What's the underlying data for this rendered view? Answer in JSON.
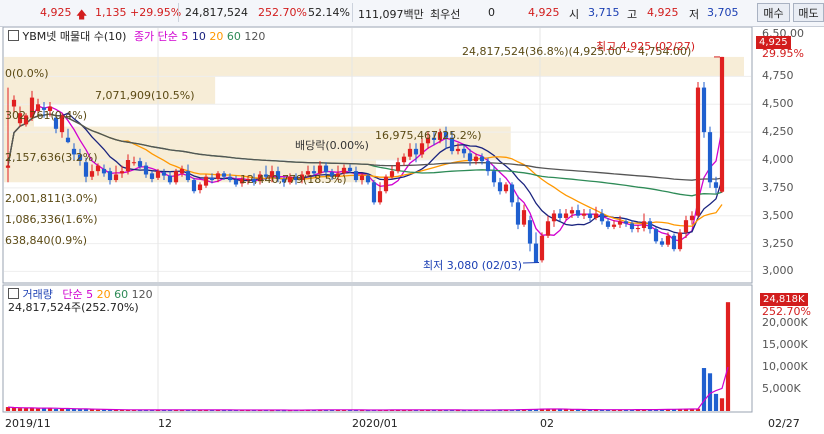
{
  "toolbar": {
    "price": "4,925",
    "change": "1,135",
    "change_pct": "+29.95%",
    "volume": "24,817,524",
    "vol_ratio": "252.70%",
    "turnover_pct": "52.14%",
    "amount": "111,097백만",
    "best_sell_label": "최우선",
    "best_sell_qty": "0",
    "best_price": "4,925",
    "open_label": "시",
    "open": "3,715",
    "high_label": "고",
    "high": "4,925",
    "low_label": "저",
    "low": "3,705",
    "buy_button": "매수",
    "sell_button": "매도"
  },
  "price_panel": {
    "title": "YBM넷 매물대 수(10)",
    "ma_label": "종가 단순",
    "ma_periods": [
      "5",
      "10",
      "20",
      "60",
      "120"
    ],
    "ma_colors": [
      "#d000d0",
      "#1a237e",
      "#ff9800",
      "#2e8b57",
      "#555555"
    ],
    "top_right_partial": "6,50.00",
    "price_badge": "4,925",
    "pct_badge": "29.95%",
    "high_annotation": "최고 4,925 (02/27)",
    "low_annotation": "최저 3,080 (02/03)",
    "dividend_label": "배당락(0.00%)",
    "volume_profile_labels": [
      "24,817,524(36.8%)(4,925.00 ~ 4,754.00)",
      "7,071,909(10.5%)",
      "16,975,467(25.2%)",
      "2,157,636(3.2%)",
      "12,440,779(18.5%)",
      "2,001,811(3.0%)",
      "1,086,336(1.6%)",
      "638,840(0.9%)",
      "302,761(0.4%)",
      "0(0.0%)"
    ],
    "y_ticks": [
      "4,750",
      "4,500",
      "4,250",
      "4,000",
      "3,750",
      "3,500",
      "3,250",
      "3,000"
    ]
  },
  "volume_panel": {
    "title": "거래량",
    "ma_label": "단순",
    "ma_periods": [
      "5",
      "20",
      "60",
      "120"
    ],
    "current": "24,817,524주(252.70%)",
    "vol_badge": "24,818K",
    "pct_badge": "252.70%",
    "y_ticks": [
      "20,000K",
      "15,000K",
      "10,000K",
      "5,000K"
    ]
  },
  "x_axis": {
    "ticks": [
      "2019/11",
      "12",
      "2020/01",
      "02"
    ],
    "right_label": "02/27"
  },
  "chart_data": {
    "type": "candlestick",
    "ylim": [
      2950,
      5050
    ],
    "candles": [
      [
        3930,
        3950,
        3800,
        4650
      ],
      [
        4480,
        4540,
        4420,
        4580
      ],
      [
        4330,
        4420,
        4300,
        4480
      ],
      [
        4320,
        4400,
        4300,
        4420
      ],
      [
        4380,
        4560,
        4350,
        4620
      ],
      [
        4440,
        4500,
        4400,
        4550
      ],
      [
        4470,
        4450,
        4380,
        4520
      ],
      [
        4440,
        4480,
        4390,
        4520
      ],
      [
        4380,
        4280,
        4240,
        4420
      ],
      [
        4250,
        4400,
        4200,
        4420
      ],
      [
        4200,
        4160,
        4150,
        4280
      ],
      [
        4100,
        4050,
        4000,
        4150
      ],
      [
        4050,
        4000,
        3950,
        4100
      ],
      [
        3980,
        3850,
        3800,
        4020
      ],
      [
        3850,
        3900,
        3820,
        3960
      ],
      [
        3900,
        3950,
        3860,
        3970
      ],
      [
        3920,
        3880,
        3850,
        3960
      ],
      [
        3900,
        3820,
        3780,
        3930
      ],
      [
        3820,
        3870,
        3800,
        3950
      ],
      [
        3880,
        3900,
        3840,
        3950
      ],
      [
        3900,
        4000,
        3870,
        4050
      ],
      [
        3980,
        3980,
        3950,
        4030
      ],
      [
        3990,
        3940,
        3920,
        4020
      ],
      [
        3950,
        3870,
        3840,
        3980
      ],
      [
        3880,
        3830,
        3800,
        3900
      ],
      [
        3840,
        3900,
        3820,
        3920
      ],
      [
        3890,
        3860,
        3820,
        3920
      ],
      [
        3860,
        3800,
        3780,
        3900
      ],
      [
        3800,
        3900,
        3780,
        3920
      ],
      [
        3880,
        3920,
        3850,
        3950
      ],
      [
        3900,
        3820,
        3800,
        3960
      ],
      [
        3820,
        3720,
        3700,
        3840
      ],
      [
        3730,
        3780,
        3700,
        3800
      ],
      [
        3770,
        3850,
        3750,
        3870
      ],
      [
        3840,
        3820,
        3790,
        3880
      ],
      [
        3830,
        3880,
        3800,
        3900
      ],
      [
        3880,
        3850,
        3820,
        3900
      ],
      [
        3850,
        3820,
        3800,
        3880
      ],
      [
        3820,
        3780,
        3760,
        3860
      ],
      [
        3790,
        3830,
        3760,
        3850
      ],
      [
        3830,
        3830,
        3780,
        3860
      ],
      [
        3830,
        3800,
        3770,
        3880
      ],
      [
        3810,
        3870,
        3780,
        3900
      ],
      [
        3870,
        3850,
        3820,
        3950
      ],
      [
        3850,
        3900,
        3800,
        3950
      ],
      [
        3900,
        3830,
        3800,
        3940
      ],
      [
        3830,
        3800,
        3760,
        3850
      ],
      [
        3800,
        3850,
        3780,
        3880
      ],
      [
        3850,
        3820,
        3780,
        3880
      ],
      [
        3820,
        3870,
        3790,
        3900
      ],
      [
        3870,
        3900,
        3850,
        3950
      ],
      [
        3900,
        3880,
        3860,
        3950
      ],
      [
        3880,
        3950,
        3860,
        3990
      ],
      [
        3950,
        3890,
        3850,
        3980
      ],
      [
        3890,
        3850,
        3820,
        3920
      ],
      [
        3850,
        3880,
        3820,
        3950
      ],
      [
        3880,
        3930,
        3860,
        3960
      ],
      [
        3930,
        3900,
        3880,
        3960
      ],
      [
        3900,
        3820,
        3800,
        3940
      ],
      [
        3820,
        3860,
        3780,
        3880
      ],
      [
        3860,
        3800,
        3780,
        3880
      ],
      [
        3800,
        3620,
        3600,
        3820
      ],
      [
        3620,
        3720,
        3600,
        3800
      ],
      [
        3720,
        3850,
        3700,
        3870
      ],
      [
        3850,
        3900,
        3830,
        3950
      ],
      [
        3900,
        3980,
        3880,
        4020
      ],
      [
        3980,
        4030,
        3950,
        4060
      ],
      [
        4030,
        4100,
        4000,
        4150
      ],
      [
        4100,
        4050,
        3980,
        4150
      ],
      [
        4050,
        4150,
        4020,
        4200
      ],
      [
        4150,
        4200,
        4100,
        4250
      ],
      [
        4200,
        4180,
        4130,
        4260
      ],
      [
        4180,
        4250,
        4150,
        4280
      ],
      [
        4250,
        4200,
        4100,
        4300
      ],
      [
        4200,
        4080,
        4050,
        4260
      ],
      [
        4080,
        4100,
        4050,
        4150
      ],
      [
        4100,
        4060,
        4020,
        4130
      ],
      [
        4060,
        3990,
        3950,
        4100
      ],
      [
        3990,
        4030,
        3960,
        4060
      ],
      [
        4030,
        3990,
        3960,
        4060
      ],
      [
        3990,
        3900,
        3860,
        4020
      ],
      [
        3900,
        3800,
        3760,
        3950
      ],
      [
        3800,
        3720,
        3690,
        3840
      ],
      [
        3720,
        3780,
        3700,
        3800
      ],
      [
        3780,
        3620,
        3580,
        3800
      ],
      [
        3620,
        3420,
        3380,
        3680
      ],
      [
        3420,
        3550,
        3400,
        3600
      ],
      [
        3460,
        3250,
        3180,
        3500
      ],
      [
        3250,
        3080,
        3080,
        3350
      ],
      [
        3100,
        3320,
        3080,
        3350
      ],
      [
        3320,
        3450,
        3300,
        3500
      ],
      [
        3450,
        3520,
        3400,
        3550
      ],
      [
        3520,
        3480,
        3450,
        3560
      ],
      [
        3480,
        3520,
        3460,
        3560
      ],
      [
        3520,
        3550,
        3480,
        3580
      ],
      [
        3550,
        3500,
        3480,
        3600
      ],
      [
        3500,
        3520,
        3470,
        3560
      ],
      [
        3520,
        3480,
        3450,
        3560
      ],
      [
        3480,
        3520,
        3460,
        3580
      ],
      [
        3520,
        3450,
        3420,
        3560
      ],
      [
        3450,
        3400,
        3380,
        3480
      ],
      [
        3400,
        3420,
        3380,
        3460
      ],
      [
        3420,
        3450,
        3390,
        3500
      ],
      [
        3450,
        3430,
        3400,
        3480
      ],
      [
        3430,
        3380,
        3350,
        3460
      ],
      [
        3380,
        3390,
        3350,
        3420
      ],
      [
        3390,
        3450,
        3360,
        3520
      ],
      [
        3450,
        3380,
        3340,
        3480
      ],
      [
        3380,
        3270,
        3250,
        3400
      ],
      [
        3270,
        3240,
        3220,
        3300
      ],
      [
        3240,
        3320,
        3220,
        3350
      ],
      [
        3320,
        3200,
        3180,
        3340
      ],
      [
        3200,
        3350,
        3180,
        3380
      ],
      [
        3350,
        3460,
        3300,
        3500
      ],
      [
        3460,
        3500,
        3420,
        3540
      ],
      [
        3500,
        4650,
        3480,
        4700
      ],
      [
        4650,
        4250,
        4200,
        4700
      ],
      [
        4250,
        3800,
        3750,
        4300
      ],
      [
        3800,
        3750,
        3700,
        3850
      ],
      [
        3715,
        4925,
        3705,
        4925
      ]
    ],
    "volumes": [
      900,
      700,
      650,
      600,
      800,
      550,
      700,
      600,
      500,
      550,
      450,
      500,
      450,
      400,
      350,
      300,
      300,
      320,
      280,
      250,
      260,
      240,
      220,
      230,
      260,
      300,
      280,
      260,
      240,
      220,
      230,
      250,
      270,
      260,
      240,
      230,
      220,
      250,
      240,
      230,
      220,
      240,
      260,
      230,
      210,
      220,
      200,
      210,
      220,
      230,
      240,
      250,
      260,
      280,
      300,
      270,
      250,
      240,
      230,
      220,
      210,
      230,
      250,
      270,
      260,
      240,
      220,
      230,
      250,
      260,
      280,
      270,
      250,
      240,
      230,
      220,
      210,
      230,
      250,
      240,
      230,
      240,
      260,
      280,
      300,
      350,
      420,
      380,
      450,
      520,
      480,
      420,
      380,
      360,
      340,
      320,
      310,
      300,
      290,
      300,
      310,
      320,
      300,
      290,
      310,
      320,
      330,
      340,
      350,
      380,
      400,
      420,
      450,
      480,
      500,
      520,
      9800,
      8600,
      3900,
      2900,
      24818
    ],
    "volume_ylim": [
      0,
      26000
    ],
    "profile": [
      {
        "from": 4754,
        "to": 4925,
        "pct": 36.8
      },
      {
        "from": 4500,
        "to": 4754,
        "pct": 10.5
      },
      {
        "from": 4300,
        "to": 4500,
        "pct": 0.4
      },
      {
        "from": 4000,
        "to": 4300,
        "pct": 25.2
      },
      {
        "from": 3800,
        "to": 4000,
        "pct": 18.5
      }
    ]
  }
}
